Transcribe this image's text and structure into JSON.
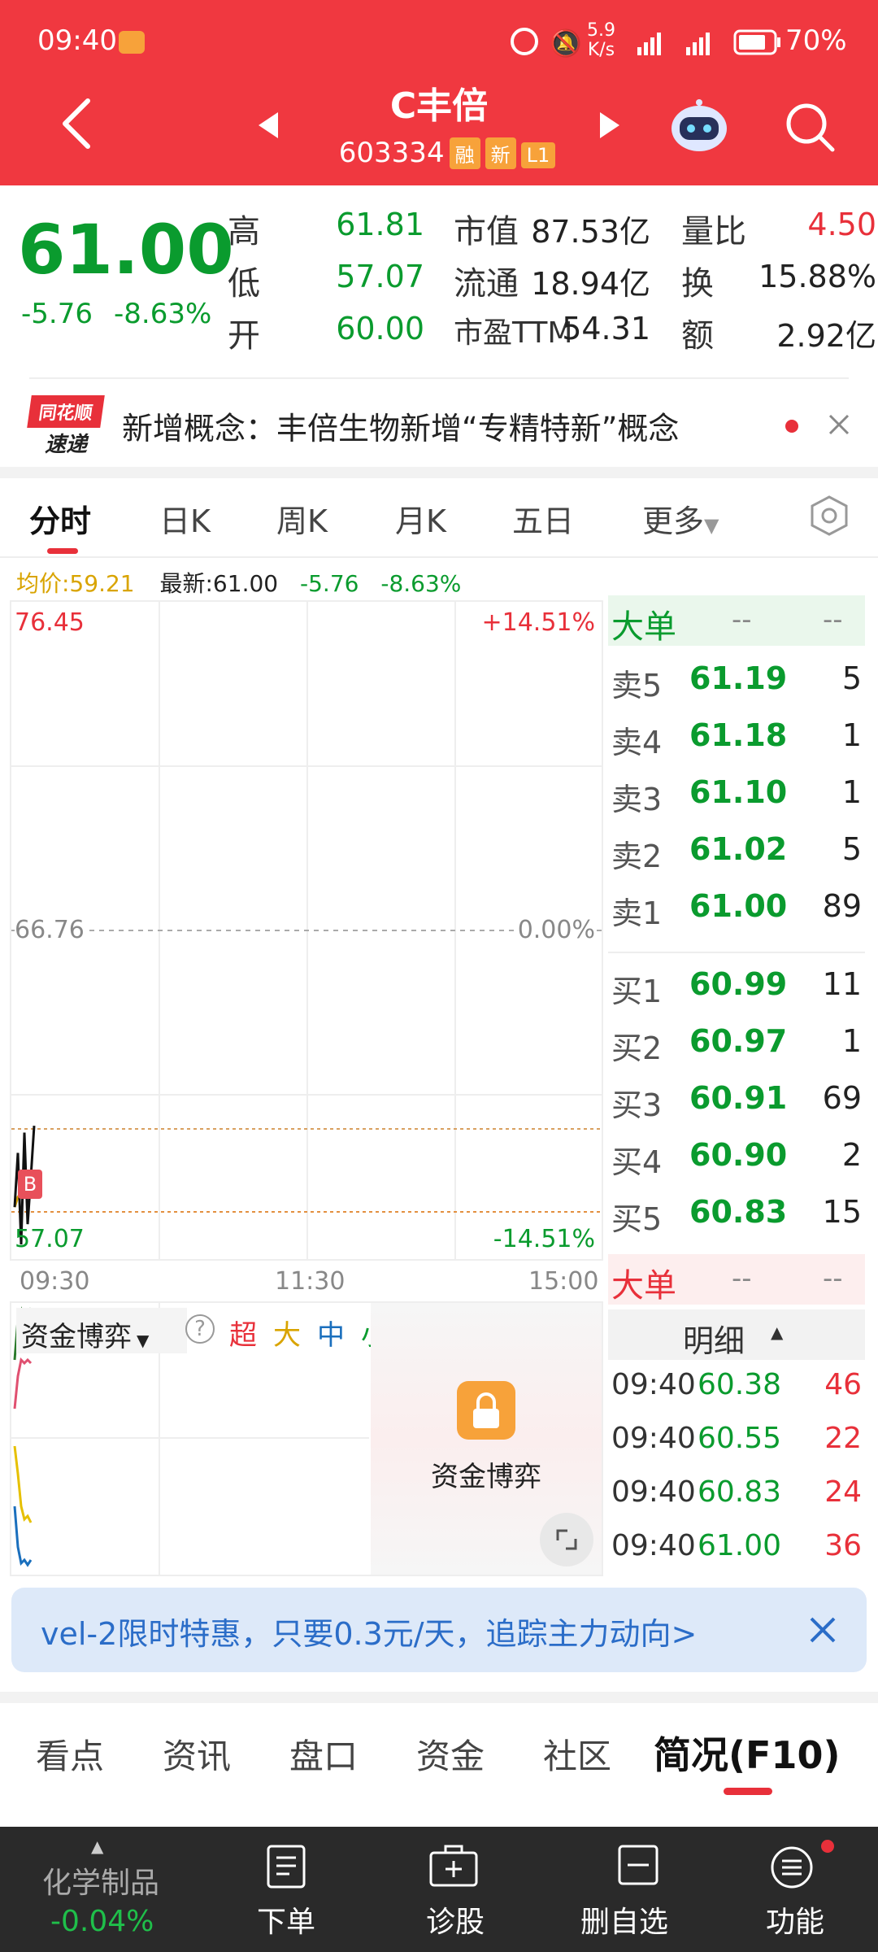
{
  "status_bar": {
    "time": "09:40",
    "net_speed_top": "5.9",
    "net_speed_bottom": "K/s",
    "battery": "70%"
  },
  "header": {
    "title": "C丰倍",
    "code": "603334",
    "badges": [
      "融",
      "新",
      "L1"
    ]
  },
  "quote": {
    "price": "61.00",
    "change": "-5.76",
    "change_pct": "-8.63%",
    "rows": [
      {
        "l1": "高",
        "v1": "61.81",
        "l2": "市值",
        "v2": "87.53亿",
        "l3": "量比",
        "v3": "4.50"
      },
      {
        "l1": "低",
        "v1": "57.07",
        "l2": "流通",
        "v2": "18.94亿",
        "l3": "换",
        "v3": "15.88%"
      },
      {
        "l1": "开",
        "v1": "60.00",
        "l2": "市盈TTM",
        "v2": "54.31",
        "l3": "额",
        "v3": "2.92亿"
      }
    ]
  },
  "news": {
    "logo_top": "同花顺",
    "logo_bottom": "速递",
    "text": "新增概念：丰倍生物新增“专精特新”概念"
  },
  "chart_tabs": [
    "分时",
    "日K",
    "周K",
    "月K",
    "五日",
    "更多"
  ],
  "chart_info": {
    "avg": "均价:59.21",
    "latest": "最新:61.00",
    "change": "-5.76",
    "change_pct": "-8.63%"
  },
  "chart_data": {
    "type": "line",
    "y_top": "76.45",
    "y_mid": "66.76",
    "y_bottom": "57.07",
    "pct_top": "+14.51%",
    "pct_mid": "0.00%",
    "pct_bottom": "-14.51%",
    "x_labels": [
      "09:30",
      "11:30",
      "15:00"
    ],
    "ylim": [
      57.07,
      76.45
    ],
    "price_series": [
      58.6,
      60.2,
      57.5,
      60.8,
      58.1,
      59.5,
      61.0
    ],
    "avg_series": [
      58.6,
      58.9,
      59.0,
      59.1,
      59.1,
      59.2,
      59.21
    ],
    "marker": "B"
  },
  "order_book": {
    "big_label": "大单",
    "big_val1": "--",
    "big_val2": "--",
    "asks": [
      {
        "label": "卖5",
        "price": "61.19",
        "vol": "5"
      },
      {
        "label": "卖4",
        "price": "61.18",
        "vol": "1"
      },
      {
        "label": "卖3",
        "price": "61.10",
        "vol": "1"
      },
      {
        "label": "卖2",
        "price": "61.02",
        "vol": "5"
      },
      {
        "label": "卖1",
        "price": "61.00",
        "vol": "89"
      }
    ],
    "bids": [
      {
        "label": "买1",
        "price": "60.99",
        "vol": "11"
      },
      {
        "label": "买2",
        "price": "60.97",
        "vol": "1"
      },
      {
        "label": "买3",
        "price": "60.91",
        "vol": "69"
      },
      {
        "label": "买4",
        "price": "60.90",
        "vol": "2"
      },
      {
        "label": "买5",
        "price": "60.83",
        "vol": "15"
      }
    ],
    "big_label2": "大单",
    "big2_val1": "--",
    "big2_val2": "--",
    "detail_header": "明细",
    "details": [
      {
        "time": "09:40",
        "price": "60.38",
        "vol": "46"
      },
      {
        "time": "09:40",
        "price": "60.55",
        "vol": "22"
      },
      {
        "time": "09:40",
        "price": "60.83",
        "vol": "24"
      },
      {
        "time": "09:40",
        "price": "61.00",
        "vol": "36"
      }
    ]
  },
  "fund_panel": {
    "selector": "资金博弈",
    "help": "?",
    "legend": [
      "超",
      "大",
      "中",
      "小"
    ],
    "locked_label": "资金博弈"
  },
  "promo": {
    "text": "vel-2限时特惠，只要0.3元/天，追踪主力动向>"
  },
  "bottom_tabs": [
    "看点",
    "资讯",
    "盘口",
    "资金",
    "社区",
    "简况(F10)"
  ],
  "bottom_nav": {
    "sector_name": "化学制品",
    "sector_change": "-0.04%",
    "items": [
      "下单",
      "诊股",
      "删自选",
      "功能"
    ]
  },
  "colors": {
    "header_red": "#f03840",
    "down_green": "#0a9b2e",
    "up_red": "#e8303a",
    "nav_dark": "#2a2a2a"
  }
}
